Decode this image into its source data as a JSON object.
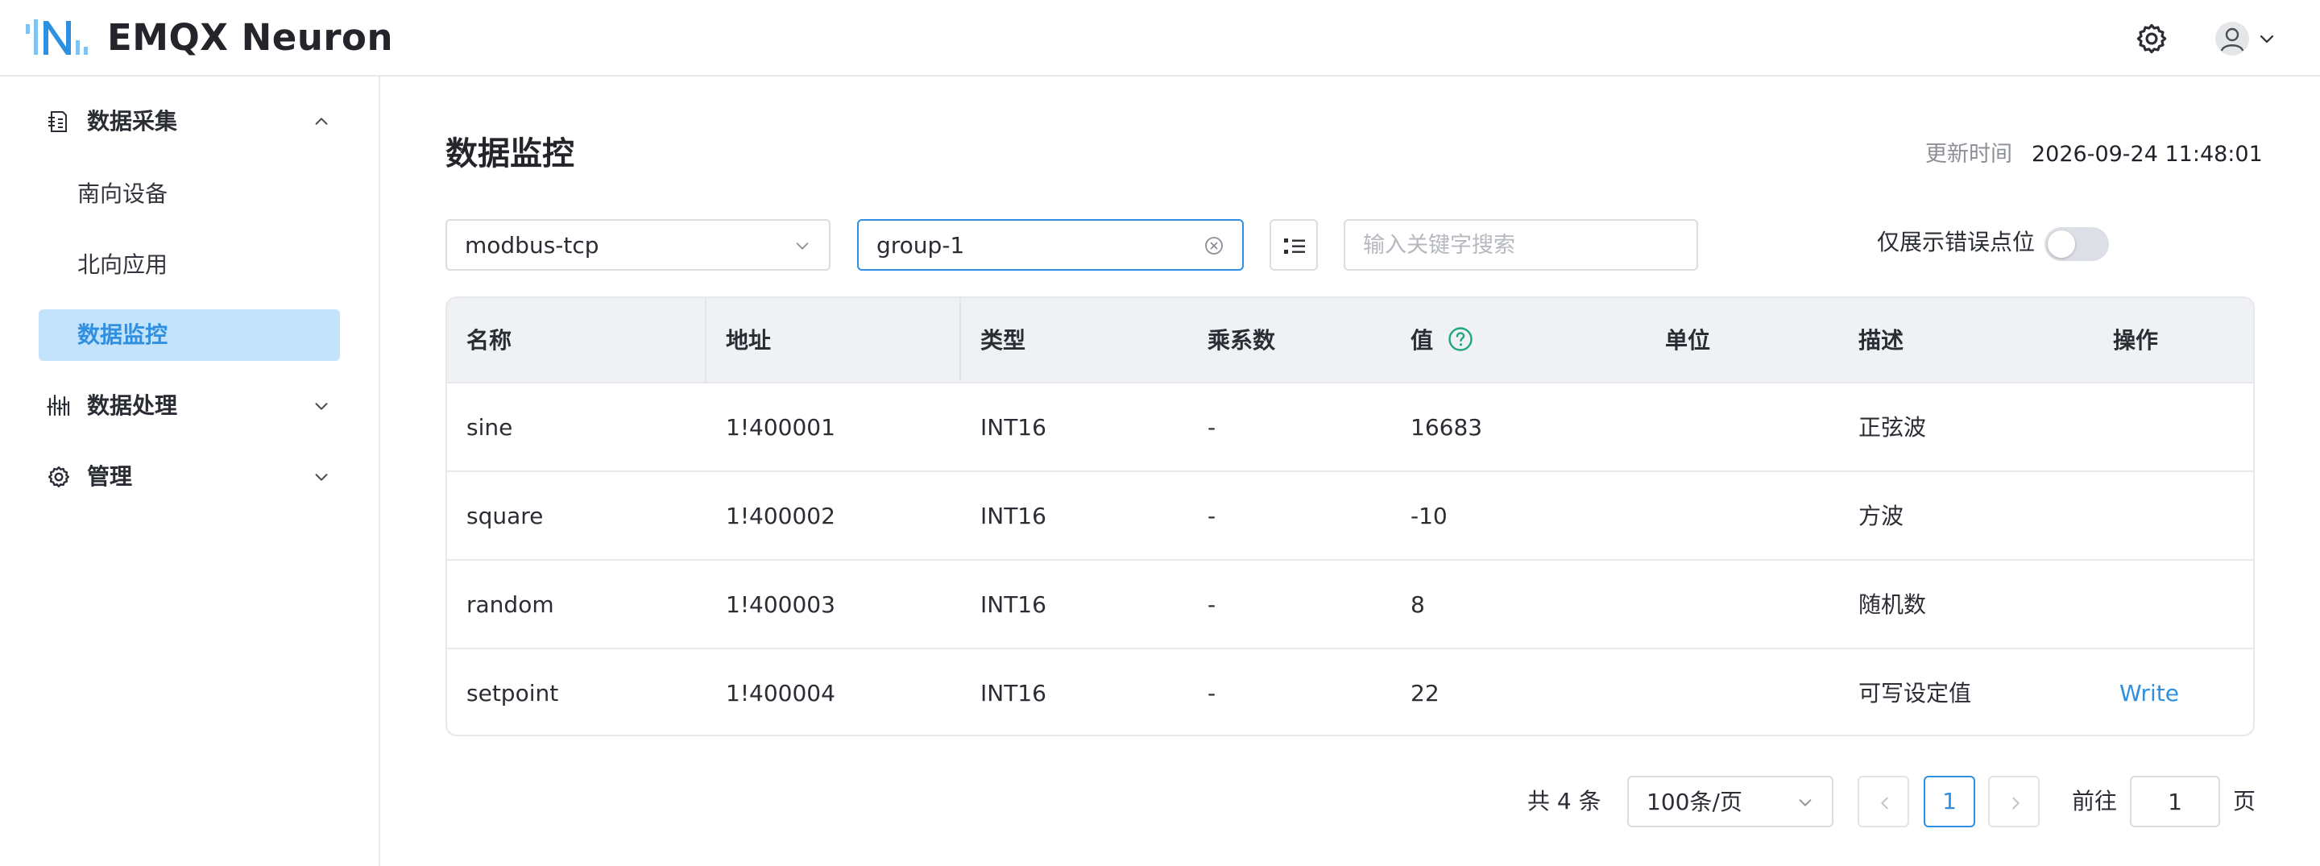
{
  "app": {
    "brand": "EMQX Neuron",
    "icons": {
      "logo": "neuron-logo",
      "settings": "gear-icon",
      "user": "user-avatar-icon",
      "caret": "chevron-down-icon"
    },
    "accent_color": "#2f8fe0"
  },
  "sidebar": {
    "groups": [
      {
        "label": "数据采集",
        "icon": "data-collect-icon",
        "expanded": true
      },
      {
        "label": "数据处理",
        "icon": "data-process-icon",
        "expanded": false
      },
      {
        "label": "管理",
        "icon": "gear-icon",
        "expanded": false
      }
    ],
    "items": [
      {
        "label": "南向设备",
        "active": false
      },
      {
        "label": "北向应用",
        "active": false
      },
      {
        "label": "数据监控",
        "active": true
      }
    ]
  },
  "page": {
    "title": "数据监控",
    "update_label": "更新时间",
    "update_time": "2026-09-24 11:48:01"
  },
  "filters": {
    "node": "modbus-tcp",
    "group": "group-1",
    "search_placeholder": "输入关键字搜索",
    "search_value": "",
    "only_errors_label": "仅展示错误点位",
    "only_errors": false
  },
  "table": {
    "headers": [
      "名称",
      "地址",
      "类型",
      "乘系数",
      "值",
      "单位",
      "描述",
      "操作"
    ],
    "rows": [
      {
        "name": "sine",
        "address": "1!400001",
        "type": "INT16",
        "decimal": "-",
        "value": "16683",
        "unit": "",
        "description": "正弦波",
        "action": ""
      },
      {
        "name": "square",
        "address": "1!400002",
        "type": "INT16",
        "decimal": "-",
        "value": "-10",
        "unit": "",
        "description": "方波",
        "action": ""
      },
      {
        "name": "random",
        "address": "1!400003",
        "type": "INT16",
        "decimal": "-",
        "value": "8",
        "unit": "",
        "description": "随机数",
        "action": ""
      },
      {
        "name": "setpoint",
        "address": "1!400004",
        "type": "INT16",
        "decimal": "-",
        "value": "22",
        "unit": "",
        "description": "可写设定值",
        "action": "Write"
      }
    ]
  },
  "pagination": {
    "total_text": "共 4 条",
    "page_size": "100条/页",
    "current_page": "1",
    "goto_label": "前往",
    "goto_value": "1",
    "goto_unit": "页"
  }
}
